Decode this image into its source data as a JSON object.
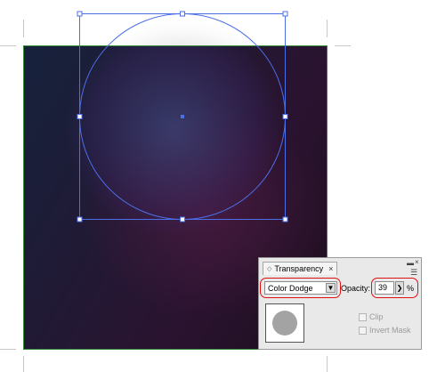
{
  "panel": {
    "tab_title": "Transparency",
    "close_glyph": "×",
    "blend_mode": "Color Dodge",
    "opacity_label": "Opacity:",
    "opacity_value": "39",
    "percent_sign": "%",
    "clip_label": "Clip",
    "invert_mask_label": "Invert Mask"
  },
  "icons": {
    "tab_collapse": "collapse-arrows-icon",
    "menu": "panel-menu-icon",
    "dropdown": "chevron-down-icon",
    "stepper": "chevron-right-icon"
  },
  "colors": {
    "selection": "#4a6fe8",
    "artboard_border": "#3a8a3a",
    "highlight_ring": "#e01010",
    "thumbnail_circle": "#a3a3a3"
  }
}
